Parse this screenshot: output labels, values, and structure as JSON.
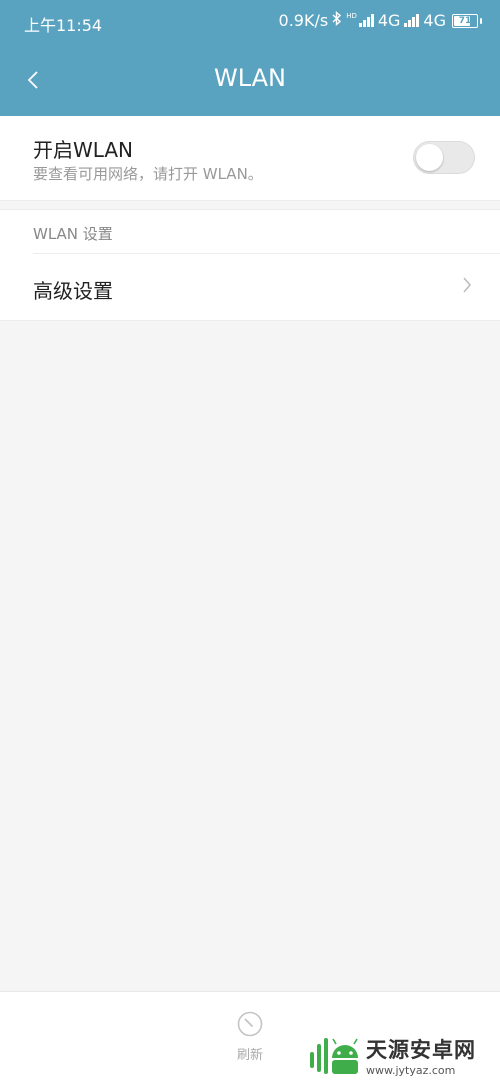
{
  "status_bar": {
    "time": "上午11:54",
    "speed": "0.9K/s",
    "network1": "4G",
    "network2": "4G",
    "battery": "71",
    "hd": "HD"
  },
  "header": {
    "title": "WLAN"
  },
  "wlan_toggle": {
    "title": "开启WLAN",
    "subtitle": "要查看可用网络，请打开 WLAN。",
    "enabled": false
  },
  "settings_section": {
    "header": "WLAN 设置",
    "advanced_label": "高级设置"
  },
  "bottom_bar": {
    "refresh_label": "刷新"
  },
  "watermark": {
    "name": "天源安卓网",
    "url": "www.jytyaz.com"
  },
  "colors": {
    "header_bg": "#5aa3c0",
    "page_bg": "#f5f5f5",
    "watermark_green": "#3fae4a"
  }
}
